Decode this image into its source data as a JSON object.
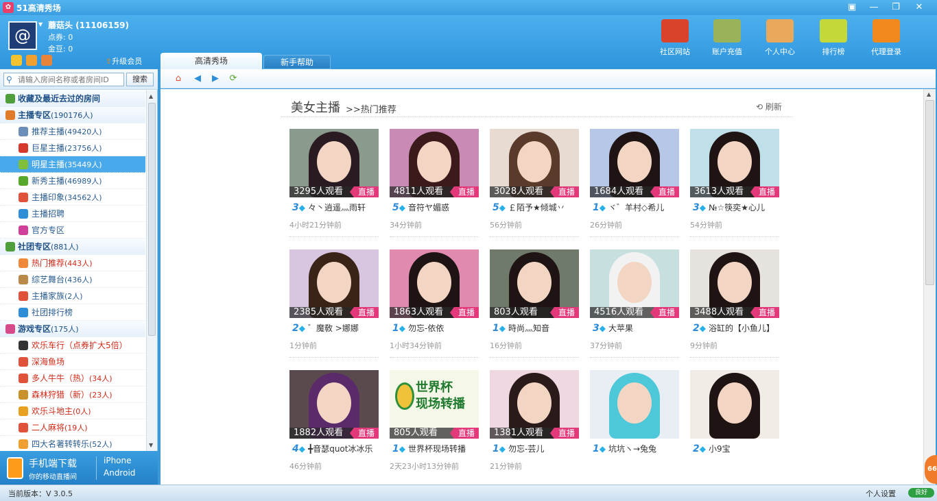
{
  "app": {
    "title": "51高清秀场",
    "icon": "app-logo-icon"
  },
  "window_controls": [
    "restore-small-icon",
    "minimize-icon",
    "maximize-icon",
    "close-icon"
  ],
  "user": {
    "avatar_glyph": "@",
    "name": "蘑菇头 (11106159)",
    "points": "点券: 0",
    "gold": "金豆: 0",
    "upgrade": "升级会员"
  },
  "header_buttons": [
    {
      "label": "社区网站",
      "icon": "house-icon",
      "color": "#d9432b"
    },
    {
      "label": "账户充值",
      "icon": "money-stack-icon",
      "color": "#9ab35a"
    },
    {
      "label": "个人中心",
      "icon": "user-group-icon",
      "color": "#e8a95c"
    },
    {
      "label": "排行榜",
      "icon": "ranking-icon",
      "color": "#c4d83a"
    },
    {
      "label": "代理登录",
      "icon": "agent-arrow-icon",
      "color": "#f08a1e"
    }
  ],
  "tabs": {
    "main": "高清秀场",
    "help": "新手帮助"
  },
  "search": {
    "placeholder": "请输入房间名称或者房间ID",
    "button": "搜索"
  },
  "tree": [
    {
      "type": "cat",
      "label": "收藏及最近去过的房间",
      "count": "",
      "color": "#4f9e3c"
    },
    {
      "type": "cat",
      "label": "主播专区",
      "count": "(190176人)",
      "color": "#e07b2a"
    },
    {
      "type": "item",
      "label": "推荐主播",
      "count": "(49420人)",
      "color": "#6b8fb8"
    },
    {
      "type": "item",
      "label": "巨星主播",
      "count": "(23756人)",
      "color": "#d63a2c"
    },
    {
      "type": "item",
      "label": "明星主播",
      "count": "(35449人)",
      "color": "#7fbf3a",
      "selected": true
    },
    {
      "type": "item",
      "label": "新秀主播",
      "count": "(46989人)",
      "color": "#58a82c"
    },
    {
      "type": "item",
      "label": "主播印象",
      "count": "(34562人)",
      "color": "#e0533a"
    },
    {
      "type": "item",
      "label": "主播招聘",
      "count": "",
      "color": "#2e8fd8"
    },
    {
      "type": "item",
      "label": "官方专区",
      "count": "",
      "color": "#d0409a"
    },
    {
      "type": "cat",
      "label": "社团专区",
      "count": "(881人)",
      "color": "#4f9e3c"
    },
    {
      "type": "item",
      "label": "热门推荐",
      "count": "(443人)",
      "color": "#f08a3a",
      "red": true
    },
    {
      "type": "item",
      "label": "综艺舞台",
      "count": "(436人)",
      "color": "#b98a4a"
    },
    {
      "type": "item",
      "label": "主播家族",
      "count": "(2人)",
      "color": "#e0533a"
    },
    {
      "type": "item",
      "label": "社团排行榜",
      "count": "",
      "color": "#2e8fd8"
    },
    {
      "type": "cat",
      "label": "游戏专区",
      "count": "(175人)",
      "color": "#d64a8a"
    },
    {
      "type": "item",
      "label": "欢乐车行（点券扩大5倍）",
      "count": "",
      "color": "#333333",
      "red": true
    },
    {
      "type": "item",
      "label": "深海鱼场",
      "count": "",
      "color": "#e0533a",
      "red": true
    },
    {
      "type": "item",
      "label": "多人牛牛（热）",
      "count": "(34人)",
      "color": "#e0533a",
      "red": true
    },
    {
      "type": "item",
      "label": "森林狩猎（新）",
      "count": "(23人)",
      "color": "#c9912a",
      "red": true
    },
    {
      "type": "item",
      "label": "欢乐斗地主",
      "count": "(0人)",
      "color": "#e8a020",
      "red": true
    },
    {
      "type": "item",
      "label": "二人麻将",
      "count": "(19人)",
      "color": "#e0533a",
      "red": true
    },
    {
      "type": "item",
      "label": "四大名著转转乐",
      "count": "(52人)",
      "color": "#f0a030"
    }
  ],
  "mobile": {
    "title": "手机端下载",
    "sub": "你的移动直播间",
    "iphone": "iPhone",
    "android": "Android"
  },
  "section": {
    "title": "美女主播",
    "sub": ">>热门推荐",
    "refresh": "刷新"
  },
  "live_label": "直播",
  "cards": [
    {
      "viewers": "3295人观看",
      "level": "3",
      "name": "々丶逍遥灬雨轩",
      "time": "4小时21分钟前",
      "bg": "#8a9a8c",
      "hair": "#2a1a22"
    },
    {
      "viewers": "4811人观看",
      "level": "5",
      "name": "音符ヤ媚惑",
      "time": "34分钟前",
      "bg": "#c98ab6",
      "hair": "#3a1a1a"
    },
    {
      "viewers": "3028人观看",
      "level": "5",
      "name": "￡陌予★倾城丷",
      "time": "56分钟前",
      "bg": "#e8dcd2",
      "hair": "#5a3a2a"
    },
    {
      "viewers": "1684人观看",
      "level": "1",
      "name": "ヾ゛羊村◇希儿",
      "time": "26分钟前",
      "bg": "#b7c7e8",
      "hair": "#1e1414"
    },
    {
      "viewers": "3613人观看",
      "level": "3",
      "name": "№☆筷奕★心儿",
      "time": "54分钟前",
      "bg": "#bfe0e8",
      "hair": "#1e1414"
    },
    {
      "viewers": "2385人观看",
      "level": "2",
      "name": "゛魔敎 >娜娜",
      "time": "1分钟前",
      "bg": "#d8c6e0",
      "hair": "#3a2418"
    },
    {
      "viewers": "1863人观看",
      "level": "1",
      "name": "勿忘-依依",
      "time": "1小时34分钟前",
      "bg": "#e08ab0",
      "hair": "#1e1414"
    },
    {
      "viewers": "803人观看",
      "level": "1",
      "name": "時尚灬知音",
      "time": "16分钟前",
      "bg": "#6f7a6a",
      "hair": "#1e1414"
    },
    {
      "viewers": "4516人观看",
      "level": "3",
      "name": "大苹果",
      "time": "37分钟前",
      "bg": "#c8dfe0",
      "hair": "#f2f2f2"
    },
    {
      "viewers": "3488人观看",
      "level": "2",
      "name": "浴缸的【小鱼儿】",
      "time": "9分钟前",
      "bg": "#e6e2de",
      "hair": "#1e1414"
    },
    {
      "viewers": "1882人观看",
      "level": "4",
      "name": "╋音瑟quot冰冰乐",
      "time": "46分钟前",
      "bg": "#5a4a4e",
      "hair": "#5a2a6a"
    },
    {
      "viewers": "805人观看",
      "level": "1",
      "name": "世界杯现场转播",
      "time": "2天23小时13分钟前",
      "special": true,
      "special_text": "世界杯\n现场转播"
    },
    {
      "viewers": "1381人观看",
      "level": "1",
      "name": "勿忘-芸儿",
      "time": "21分钟前",
      "bg": "#f0d8e2",
      "hair": "#2a1a1a"
    },
    {
      "viewers": "",
      "level": "1",
      "name": "坑坑ヽ→兔兔",
      "time": "",
      "bg": "#e8eef4",
      "hair": "#4cc8d8",
      "nolive": true
    },
    {
      "viewers": "",
      "level": "2",
      "name": "小9宝",
      "time": "",
      "bg": "#f2ece6",
      "hair": "#1e1414",
      "nolive": true
    }
  ],
  "status": {
    "version": "当前版本：V 3.0.5",
    "settings": "个人设置",
    "net": "良好"
  }
}
